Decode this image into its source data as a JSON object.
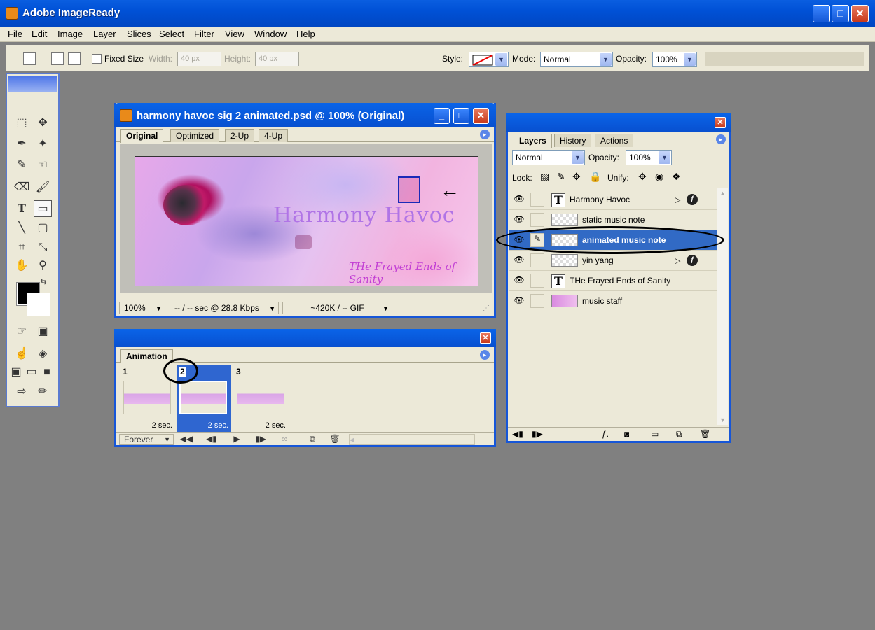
{
  "app": {
    "title": "Adobe ImageReady"
  },
  "window_buttons": {
    "minimize": "_",
    "maximize": "□",
    "close": "✕"
  },
  "menu": [
    "File",
    "Edit",
    "Image",
    "Layer",
    "Slices",
    "Select",
    "Filter",
    "View",
    "Window",
    "Help"
  ],
  "options": {
    "fixed_size_label": "Fixed Size",
    "width_label": "Width:",
    "width_value": "40 px",
    "height_label": "Height:",
    "height_value": "40 px",
    "style_label": "Style:",
    "mode_label": "Mode:",
    "mode_value": "Normal",
    "opacity_label": "Opacity:",
    "opacity_value": "100%"
  },
  "document": {
    "title": "harmony havoc sig 2 animated.psd @ 100% (Original)",
    "tabs": [
      "Original",
      "Optimized",
      "2-Up",
      "4-Up"
    ],
    "active_tab": "Original",
    "art_title": "Harmony Havoc",
    "art_subtitle": "THe Frayed Ends of Sanity",
    "zoom": "100%",
    "download_time": "-- / -- sec @ 28.8 Kbps",
    "file_size": "~420K / -- GIF"
  },
  "annotation_arrow": "←",
  "animation": {
    "tab": "Animation",
    "frames": [
      {
        "num": "1",
        "delay": "2 sec."
      },
      {
        "num": "2",
        "delay": "2 sec."
      },
      {
        "num": "3",
        "delay": "2 sec."
      }
    ],
    "loop": "Forever",
    "selected_frame": 2
  },
  "layers": {
    "tabs": [
      "Layers",
      "History",
      "Actions"
    ],
    "blend_mode": "Normal",
    "opacity_label": "Opacity:",
    "opacity_value": "100%",
    "lock_label": "Lock:",
    "unify_label": "Unify:",
    "items": [
      {
        "name": "Harmony Havoc",
        "type": "text",
        "has_effects": true
      },
      {
        "name": "static music note",
        "type": "pixel",
        "has_effects": false
      },
      {
        "name": "animated music note",
        "type": "pixel",
        "has_effects": false,
        "selected": true
      },
      {
        "name": "yin yang",
        "type": "pixel",
        "has_effects": true
      },
      {
        "name": "THe Frayed Ends of Sanity",
        "type": "text",
        "has_effects": false
      },
      {
        "name": "music staff",
        "type": "pixel",
        "has_effects": false
      }
    ]
  },
  "colors": {
    "titlebar": "#0a5ee0",
    "workspace": "#808080",
    "panel": "#ece9d8",
    "selection": "#316ac5"
  }
}
